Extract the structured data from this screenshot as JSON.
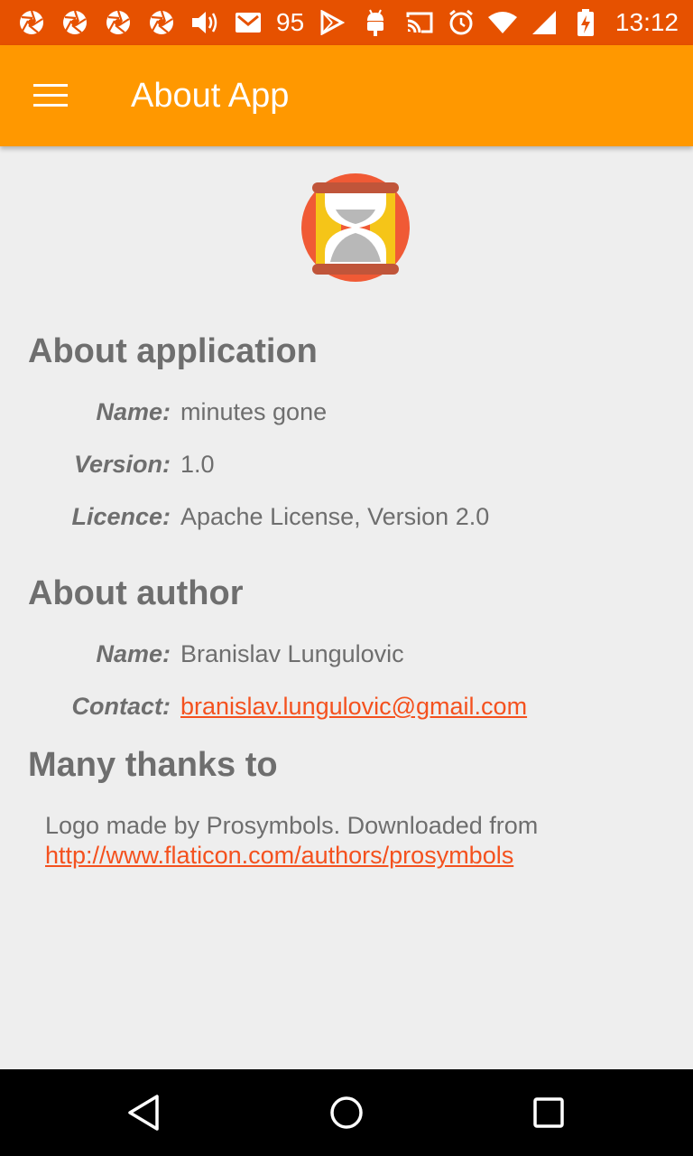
{
  "status_bar": {
    "left_icons": [
      "aperture-icon",
      "aperture-icon",
      "aperture-icon",
      "aperture-icon",
      "volume-icon",
      "mail-icon"
    ],
    "badge_number": "95",
    "extra_icons": [
      "play-store-icon",
      "android-icon"
    ],
    "right_icons": [
      "cast-icon",
      "alarm-icon",
      "wifi-icon",
      "signal-icon",
      "battery-charging-icon"
    ],
    "time": "13:12"
  },
  "app_bar": {
    "menu_icon": "hamburger-menu-icon",
    "title": "About App"
  },
  "logo": {
    "icon": "hourglass-logo-icon",
    "colors": {
      "circle": "#f05a35",
      "frame": "#c0553a",
      "posts": "#f5c518",
      "sand": "#b8b8b8"
    }
  },
  "about_application": {
    "heading": "About application",
    "name_label": "Name:",
    "name_value": "minutes gone",
    "version_label": "Version:",
    "version_value": "1.0",
    "licence_label": "Licence:",
    "licence_value": "Apache License, Version 2.0"
  },
  "about_author": {
    "heading": "About author",
    "name_label": "Name:",
    "name_value": "Branislav Lungulovic",
    "contact_label": "Contact:",
    "contact_value": "branislav.lungulovic@gmail.com"
  },
  "thanks": {
    "heading": "Many thanks to",
    "text": "Logo made by Prosymbols. Downloaded from ",
    "link": "http://www.flaticon.com/authors/prosymbols"
  },
  "nav_bar": {
    "back_icon": "back-icon",
    "home_icon": "home-icon",
    "recents_icon": "recents-icon"
  },
  "colors": {
    "status_bar": "#e65100",
    "app_bar": "#ff9800",
    "link": "#f4511e",
    "text": "#6e6e6e",
    "background": "#eeeeee"
  }
}
